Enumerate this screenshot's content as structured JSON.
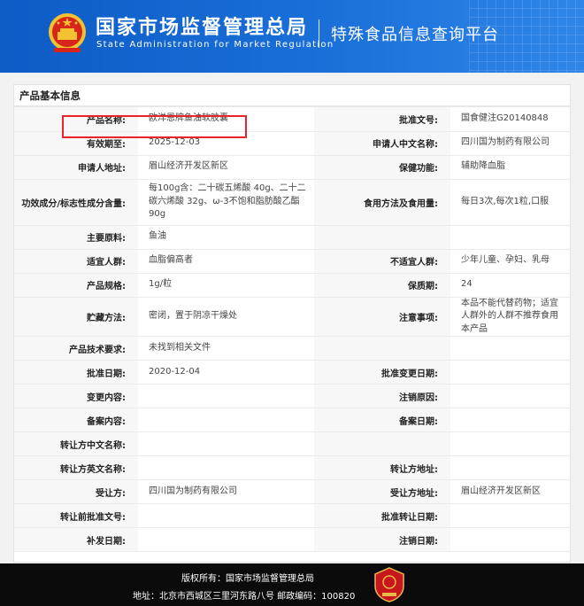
{
  "header": {
    "title_cn": "国家市场监督管理总局",
    "title_en": "State Administration  for  Market Regulation",
    "platform": "特殊食品信息查询平台"
  },
  "panel": {
    "title": "产品基本信息"
  },
  "rows": [
    {
      "l1": "产品名称:",
      "v1": "欧洋恩牌鱼油软胶囊",
      "l2": "批准文号:",
      "v2": "国食健注G20140848"
    },
    {
      "l1": "有效期至:",
      "v1": "2025-12-03",
      "l2": "申请人中文名称:",
      "v2": "四川国为制药有限公司"
    },
    {
      "l1": "申请人地址:",
      "v1": "眉山经济开发区新区",
      "l2": "保健功能:",
      "v2": "辅助降血脂"
    },
    {
      "l1": "功效成分/标志性成分含量:",
      "v1": "每100g含：二十碳五烯酸 40g、二十二碳六烯酸 32g、ω-3不饱和脂肪酸乙酯 90g",
      "l2": "食用方法及食用量:",
      "v2": "每日3次,每次1粒,口服"
    },
    {
      "l1": "主要原料:",
      "v1": "鱼油",
      "l2": "",
      "v2": ""
    },
    {
      "l1": "适宜人群:",
      "v1": "血脂偏高者",
      "l2": "不适宜人群:",
      "v2": "少年儿童、孕妇、乳母"
    },
    {
      "l1": "产品规格:",
      "v1": "1g/粒",
      "l2": "保质期:",
      "v2": "24"
    },
    {
      "l1": "贮藏方法:",
      "v1": "密闭，置于阴凉干燥处",
      "l2": "注意事项:",
      "v2": "本品不能代替药物；适宜人群外的人群不推荐食用本产品"
    },
    {
      "l1": "产品技术要求:",
      "v1": "未找到相关文件",
      "l2": "",
      "v2": ""
    },
    {
      "l1": "批准日期:",
      "v1": "2020-12-04",
      "l2": "批准变更日期:",
      "v2": ""
    },
    {
      "l1": "变更内容:",
      "v1": "",
      "l2": "注销原因:",
      "v2": ""
    },
    {
      "l1": "备案内容:",
      "v1": "",
      "l2": "备案日期:",
      "v2": ""
    },
    {
      "l1": "转让方中文名称:",
      "v1": "",
      "l2": "",
      "v2": ""
    },
    {
      "l1": "转让方英文名称:",
      "v1": "",
      "l2": "转让方地址:",
      "v2": ""
    },
    {
      "l1": "受让方:",
      "v1": "四川国为制药有限公司",
      "l2": "受让方地址:",
      "v2": "眉山经济开发区新区"
    },
    {
      "l1": "转让前批准文号:",
      "v1": "",
      "l2": "批准转让日期:",
      "v2": ""
    },
    {
      "l1": "补发日期:",
      "v1": "",
      "l2": "注销日期:",
      "v2": ""
    }
  ],
  "footer": {
    "copyright": "版权所有：国家市场监督管理总局",
    "address": "地址：北京市西城区三里河东路八号 邮政编码：100820"
  }
}
